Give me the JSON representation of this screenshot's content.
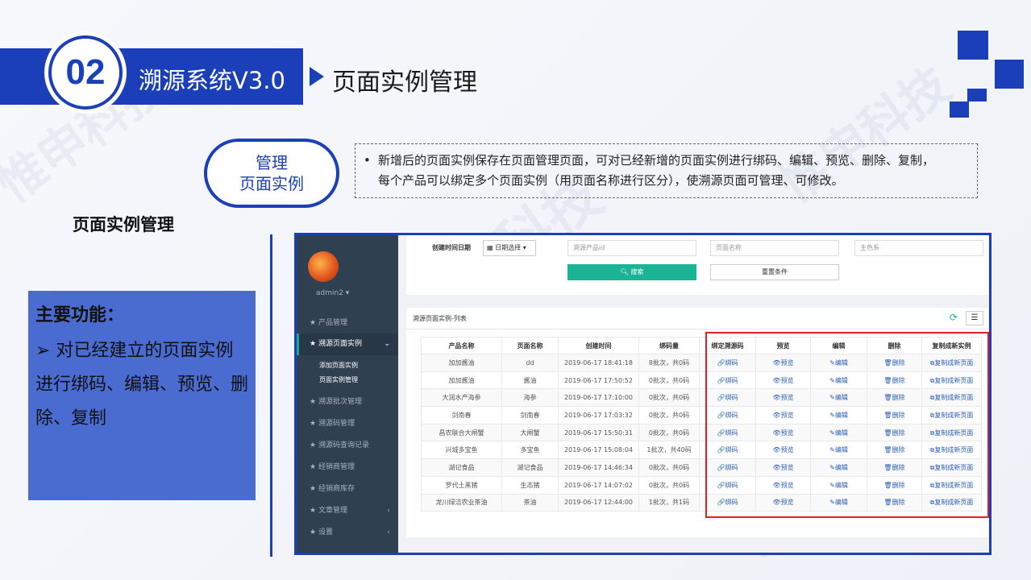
{
  "header": {
    "number": "02",
    "system_title": "溯源系统V3.0",
    "page_title": "页面实例管理"
  },
  "pill": {
    "line1": "管理",
    "line2": "页面实例"
  },
  "notice": {
    "line1": "新增后的页面实例保存在页面管理页面，可对已经新增的页面实例进行绑码、编辑、预览、删除、复制，",
    "line2": "每个产品可以绑定多个页面实例（用页面名称进行区分），使溯源页面可管理、可修改。"
  },
  "section_title": "页面实例管理",
  "feature": {
    "title": "主要功能：",
    "body": "➢ 对已经建立的页面实例进行绑码、编辑、预览、删除、复制"
  },
  "app": {
    "user": "admin2 ▾",
    "nav": [
      {
        "label": "产品管理"
      },
      {
        "label": "溯源页面实例",
        "active": true
      },
      {
        "label": "溯源批次管理"
      },
      {
        "label": "溯源码管理"
      },
      {
        "label": "溯源码查询记录"
      },
      {
        "label": "经销商管理"
      },
      {
        "label": "经销商库存"
      },
      {
        "label": "文章管理"
      },
      {
        "label": "设置"
      }
    ],
    "subnav": [
      "添加页面实例",
      "页面实例管理"
    ],
    "filter": {
      "date_label": "创建时间日期",
      "date_btn": "日期选择 ▾",
      "product_placeholder": "溯源产品id",
      "page_placeholder": "页面名称",
      "theme_placeholder": "主色系",
      "search_btn": "搜索",
      "reset_btn": "重置条件"
    },
    "panel_title": "溯源页面实例-列表",
    "columns": [
      "产品名称",
      "页面名称",
      "创建时间",
      "绑码量",
      "绑定溯源码",
      "预览",
      "编辑",
      "删除",
      "复制成新实例"
    ],
    "actions": {
      "bind": "绑码",
      "preview": "预览",
      "edit": "编辑",
      "delete": "删除",
      "copy": "复制成新页面"
    },
    "rows": [
      {
        "product": "加加酱油",
        "page": "dd",
        "time": "2019-06-17 18:41:18",
        "count": "8批次，共0码"
      },
      {
        "product": "加加酱油",
        "page": "酱油",
        "time": "2019-06-17 17:50:52",
        "count": "0批次，共0码"
      },
      {
        "product": "大润水产海参",
        "page": "海参",
        "time": "2019-06-17 17:10:00",
        "count": "0批次，共0码"
      },
      {
        "product": "剑南春",
        "page": "剑南春",
        "time": "2019-06-17 17:03:32",
        "count": "0批次，共0码"
      },
      {
        "product": "昌农联合大闸蟹",
        "page": "大闸蟹",
        "time": "2019-06-17 15:50:31",
        "count": "0批次，共0码"
      },
      {
        "product": "兴城多宝鱼",
        "page": "多宝鱼",
        "time": "2019-06-17 15:08:04",
        "count": "1批次，共40码"
      },
      {
        "product": "湖记食品",
        "page": "湖记食品",
        "time": "2019-06-17 14:46:34",
        "count": "0批次，共0码"
      },
      {
        "product": "罗代土黑猪",
        "page": "生态猪",
        "time": "2019-06-17 14:07:02",
        "count": "0批次，共0码"
      },
      {
        "product": "龙川绿洁农业茶油",
        "page": "茶油",
        "time": "2019-06-17 12:44:00",
        "count": "1批次，共1码"
      }
    ]
  }
}
